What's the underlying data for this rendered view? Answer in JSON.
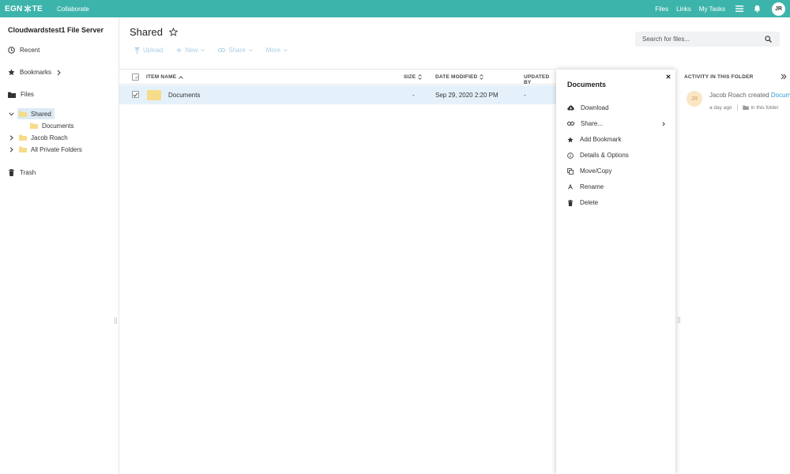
{
  "topbar": {
    "logo_left": "EGN",
    "logo_right": "TE",
    "collaborate": "Collaborate",
    "links": [
      "Files",
      "Links",
      "My Tasks"
    ],
    "avatar": "JR"
  },
  "sidebar": {
    "server_title": "Cloudwardstest1 File Server",
    "recent": "Recent",
    "bookmarks": "Bookmarks",
    "files": "Files",
    "tree": {
      "shared": "Shared",
      "documents": "Documents",
      "jacob": "Jacob Roach",
      "private": "All Private Folders"
    },
    "trash": "Trash"
  },
  "main": {
    "title": "Shared",
    "toolbar": {
      "upload": "Upload",
      "new": "New",
      "share": "Share",
      "more": "More"
    },
    "search_placeholder": "Search for files...",
    "columns": {
      "name": "ITEM NAME",
      "size": "SIZE",
      "modified": "DATE MODIFIED",
      "updated_by": "UPDATED BY"
    },
    "rows": [
      {
        "name": "Documents",
        "size": "-",
        "modified": "Sep 29, 2020 2:20 PM",
        "updated_by": "-"
      }
    ]
  },
  "context_menu": {
    "title": "Documents",
    "items": [
      "Download",
      "Share...",
      "Add Bookmark",
      "Details & Options",
      "Move/Copy",
      "Rename",
      "Delete"
    ]
  },
  "activity": {
    "header": "ACTIVITY IN THIS FOLDER",
    "avatar": "JR",
    "actor": "Jacob Roach",
    "verb": "created",
    "target": "Documents",
    "time": "a day ago",
    "where": "in this folder"
  },
  "colors": {
    "topbar": "#3db4ab",
    "selected_row": "#e5f1fa",
    "link": "#2f9fd3",
    "folder": "#f6dc8a"
  },
  "icons": [
    "clock-icon",
    "star-icon",
    "folder-icon",
    "trash-icon",
    "search-icon",
    "bell-icon",
    "menu-icon",
    "close-icon",
    "download-icon",
    "link-icon",
    "info-icon",
    "copy-icon",
    "rename-icon"
  ]
}
